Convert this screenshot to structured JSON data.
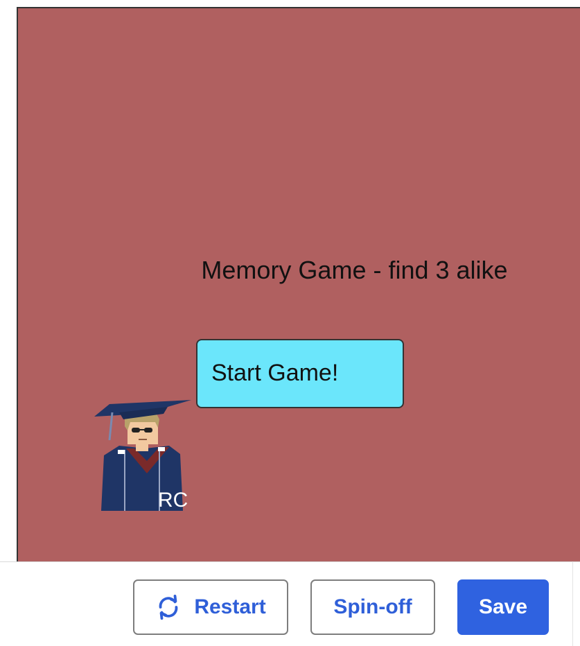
{
  "game": {
    "title": "Memory Game - find 3 alike",
    "start_label": "Start Game!",
    "avatar_initials": "RC",
    "colors": {
      "background": "#b06060",
      "start_button": "#6be6fb"
    }
  },
  "toolbar": {
    "restart_label": "Restart",
    "restart_icon": "refresh-icon",
    "spinoff_label": "Spin-off",
    "save_label": "Save",
    "colors": {
      "accent": "#2f62e0"
    }
  }
}
